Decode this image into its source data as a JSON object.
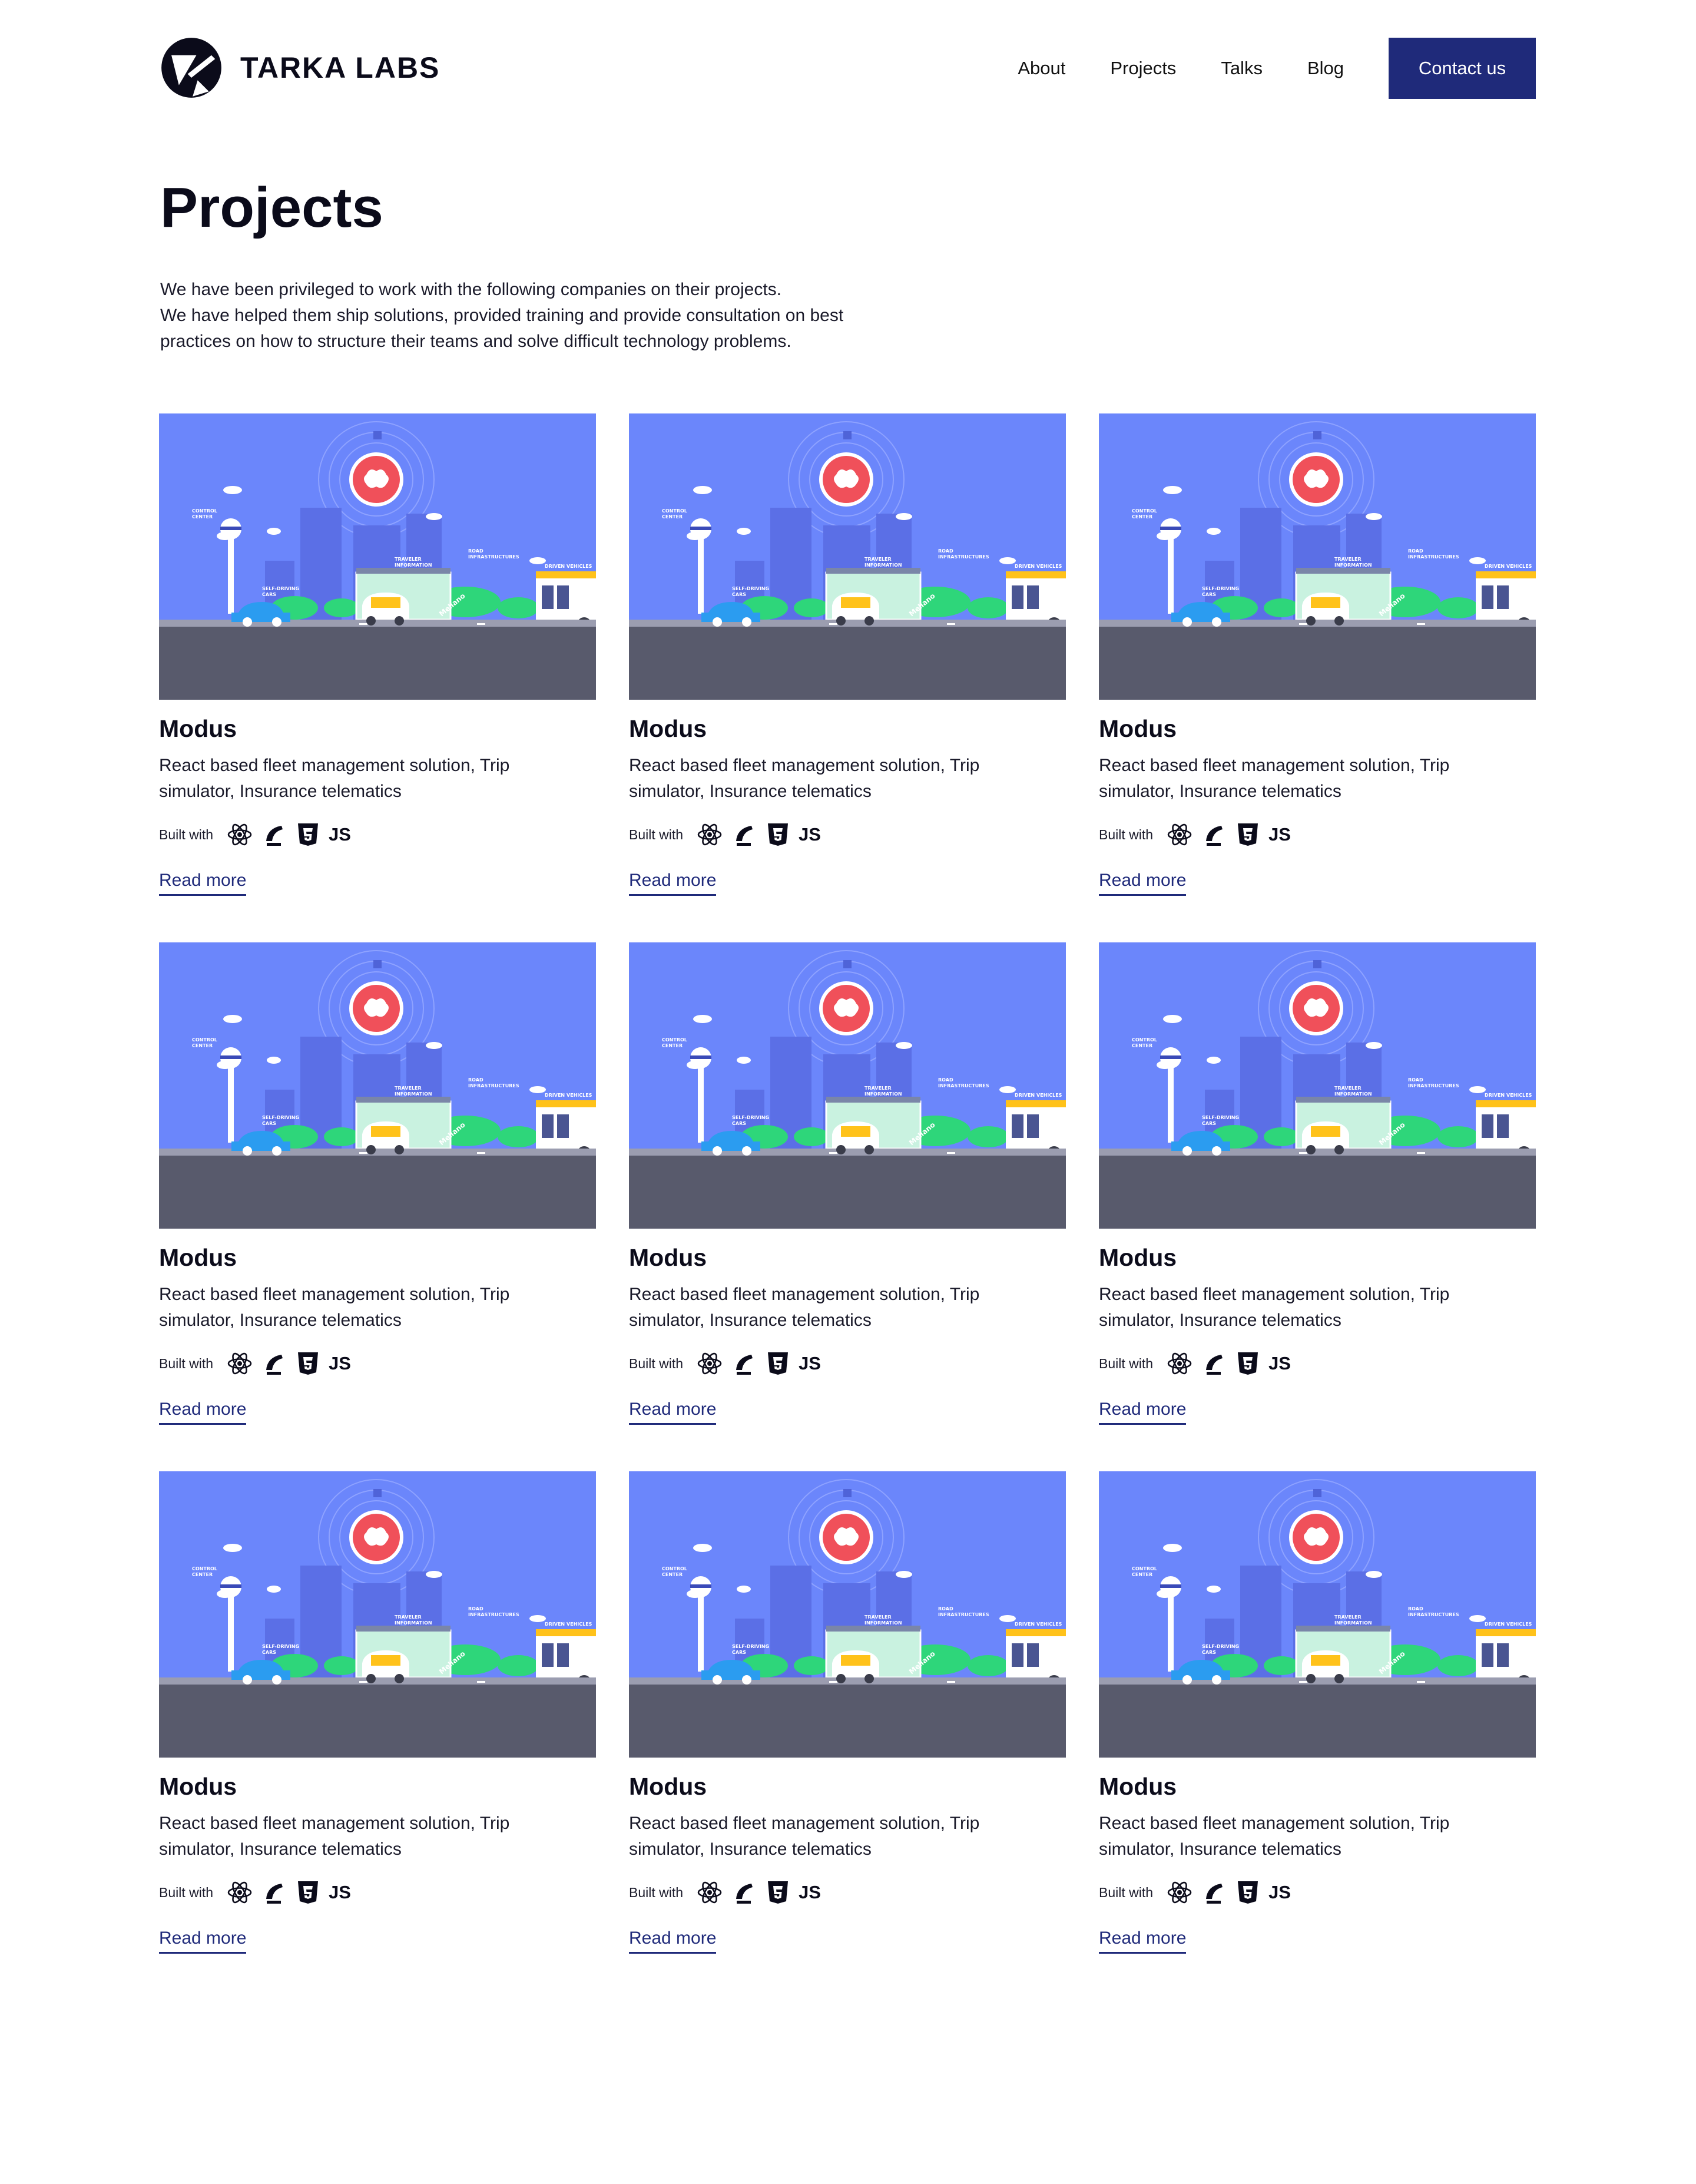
{
  "header": {
    "logo_text": "TARKA LABS",
    "nav": [
      {
        "label": "About"
      },
      {
        "label": "Projects"
      },
      {
        "label": "Talks"
      },
      {
        "label": "Blog"
      }
    ],
    "contact_label": "Contact us"
  },
  "hero": {
    "title": "Projects",
    "intro_lines": [
      "We have been privileged to work with the following companies on their projects.",
      "We have helped them ship solutions, provided training and provide consultation on best",
      "practices on how to structure their teams and solve difficult technology problems."
    ]
  },
  "illustration_labels": {
    "control_center": "CONTROL CENTER",
    "self_driving": "SELF-DRIVING CARS",
    "traveler_info": "TRAVELER INFORMATION",
    "road_infra": "ROAD INFRASTRUCTURES",
    "driven_vehicles": "DRIVEN VEHICLES",
    "brand": "Mellano"
  },
  "projects": [
    {
      "title": "Modus",
      "description": "React based fleet management solution, Trip simulator, Insurance telematics",
      "built_with_label": "Built with",
      "tech": [
        "react-icon",
        "rails-icon",
        "html5-icon"
      ],
      "js_label": "JS",
      "read_more": "Read more"
    },
    {
      "title": "Modus",
      "description": "React based fleet management solution, Trip simulator, Insurance telematics",
      "built_with_label": "Built with",
      "tech": [
        "react-icon",
        "rails-icon",
        "html5-icon"
      ],
      "js_label": "JS",
      "read_more": "Read more"
    },
    {
      "title": "Modus",
      "description": "React based fleet management solution, Trip simulator, Insurance telematics",
      "built_with_label": "Built with",
      "tech": [
        "react-icon",
        "rails-icon",
        "html5-icon"
      ],
      "js_label": "JS",
      "read_more": "Read more"
    },
    {
      "title": "Modus",
      "description": "React based fleet management solution, Trip simulator, Insurance telematics",
      "built_with_label": "Built with",
      "tech": [
        "react-icon",
        "rails-icon",
        "html5-icon"
      ],
      "js_label": "JS",
      "read_more": "Read more"
    },
    {
      "title": "Modus",
      "description": "React based fleet management solution, Trip simulator, Insurance telematics",
      "built_with_label": "Built with",
      "tech": [
        "react-icon",
        "rails-icon",
        "html5-icon"
      ],
      "js_label": "JS",
      "read_more": "Read more"
    },
    {
      "title": "Modus",
      "description": "React based fleet management solution, Trip simulator, Insurance telematics",
      "built_with_label": "Built with",
      "tech": [
        "react-icon",
        "rails-icon",
        "html5-icon"
      ],
      "js_label": "JS",
      "read_more": "Read more"
    },
    {
      "title": "Modus",
      "description": "React based fleet management solution, Trip simulator, Insurance telematics",
      "built_with_label": "Built with",
      "tech": [
        "react-icon",
        "rails-icon",
        "html5-icon"
      ],
      "js_label": "JS",
      "read_more": "Read more"
    },
    {
      "title": "Modus",
      "description": "React based fleet management solution, Trip simulator, Insurance telematics",
      "built_with_label": "Built with",
      "tech": [
        "react-icon",
        "rails-icon",
        "html5-icon"
      ],
      "js_label": "JS",
      "read_more": "Read more"
    },
    {
      "title": "Modus",
      "description": "React based fleet management solution, Trip simulator, Insurance telematics",
      "built_with_label": "Built with",
      "tech": [
        "react-icon",
        "rails-icon",
        "html5-icon"
      ],
      "js_label": "JS",
      "read_more": "Read more"
    }
  ],
  "colors": {
    "accent": "#1f2a7a",
    "sky": "#6b86fb",
    "road": "#585a6c",
    "grass": "#2ed67a",
    "brain_circle": "#f0505a"
  }
}
